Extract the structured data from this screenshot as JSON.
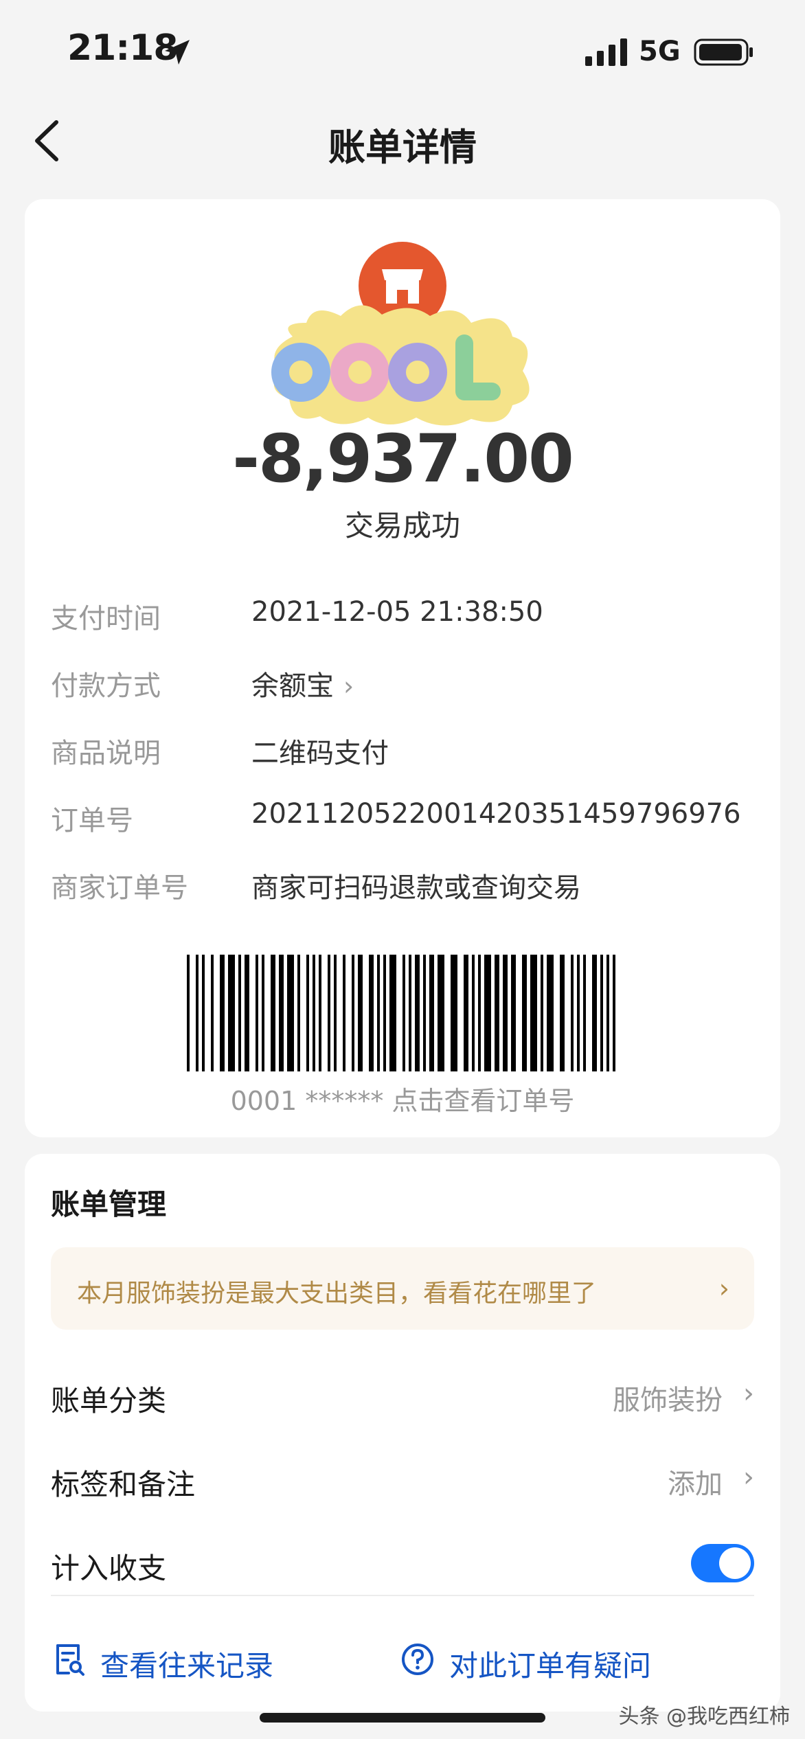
{
  "status_bar": {
    "time": "21:18",
    "network": "5G"
  },
  "nav": {
    "title": "账单详情"
  },
  "transaction": {
    "amount": "-8,937.00",
    "status": "交易成功",
    "details": [
      {
        "label": "支付时间",
        "value": "2021-12-05 21:38:50",
        "chevron": false
      },
      {
        "label": "付款方式",
        "value": "余额宝",
        "chevron": true
      },
      {
        "label": "商品说明",
        "value": "二维码支付",
        "chevron": false
      },
      {
        "label": "订单号",
        "value": "2021120522001420351459796976",
        "chevron": false
      },
      {
        "label": "商家订单号",
        "value": "商家可扫码退款或查询交易",
        "chevron": false
      }
    ],
    "barcode_caption": "0001 ****** 点击查看订单号"
  },
  "sticker": {
    "text": "COOL"
  },
  "management": {
    "title": "账单管理",
    "tip": "本月服饰装扮是最大支出类目，看看花在哪里了",
    "category": {
      "label": "账单分类",
      "value": "服饰装扮"
    },
    "tags": {
      "label": "标签和备注",
      "value": "添加"
    },
    "count_in": {
      "label": "计入收支",
      "enabled": true
    },
    "actions": {
      "history": "查看往来记录",
      "question": "对此订单有疑问"
    }
  },
  "watermark": "头条 @我吃西红柿",
  "colors": {
    "accent": "#1677ff",
    "link": "#1555c4",
    "tip": "#b08a47",
    "shop": "#e4572e"
  },
  "icons": [
    "back-icon",
    "location-arrow-icon",
    "signal-icon",
    "battery-icon",
    "shop-icon",
    "chevron-right-icon",
    "record-icon",
    "question-icon"
  ]
}
